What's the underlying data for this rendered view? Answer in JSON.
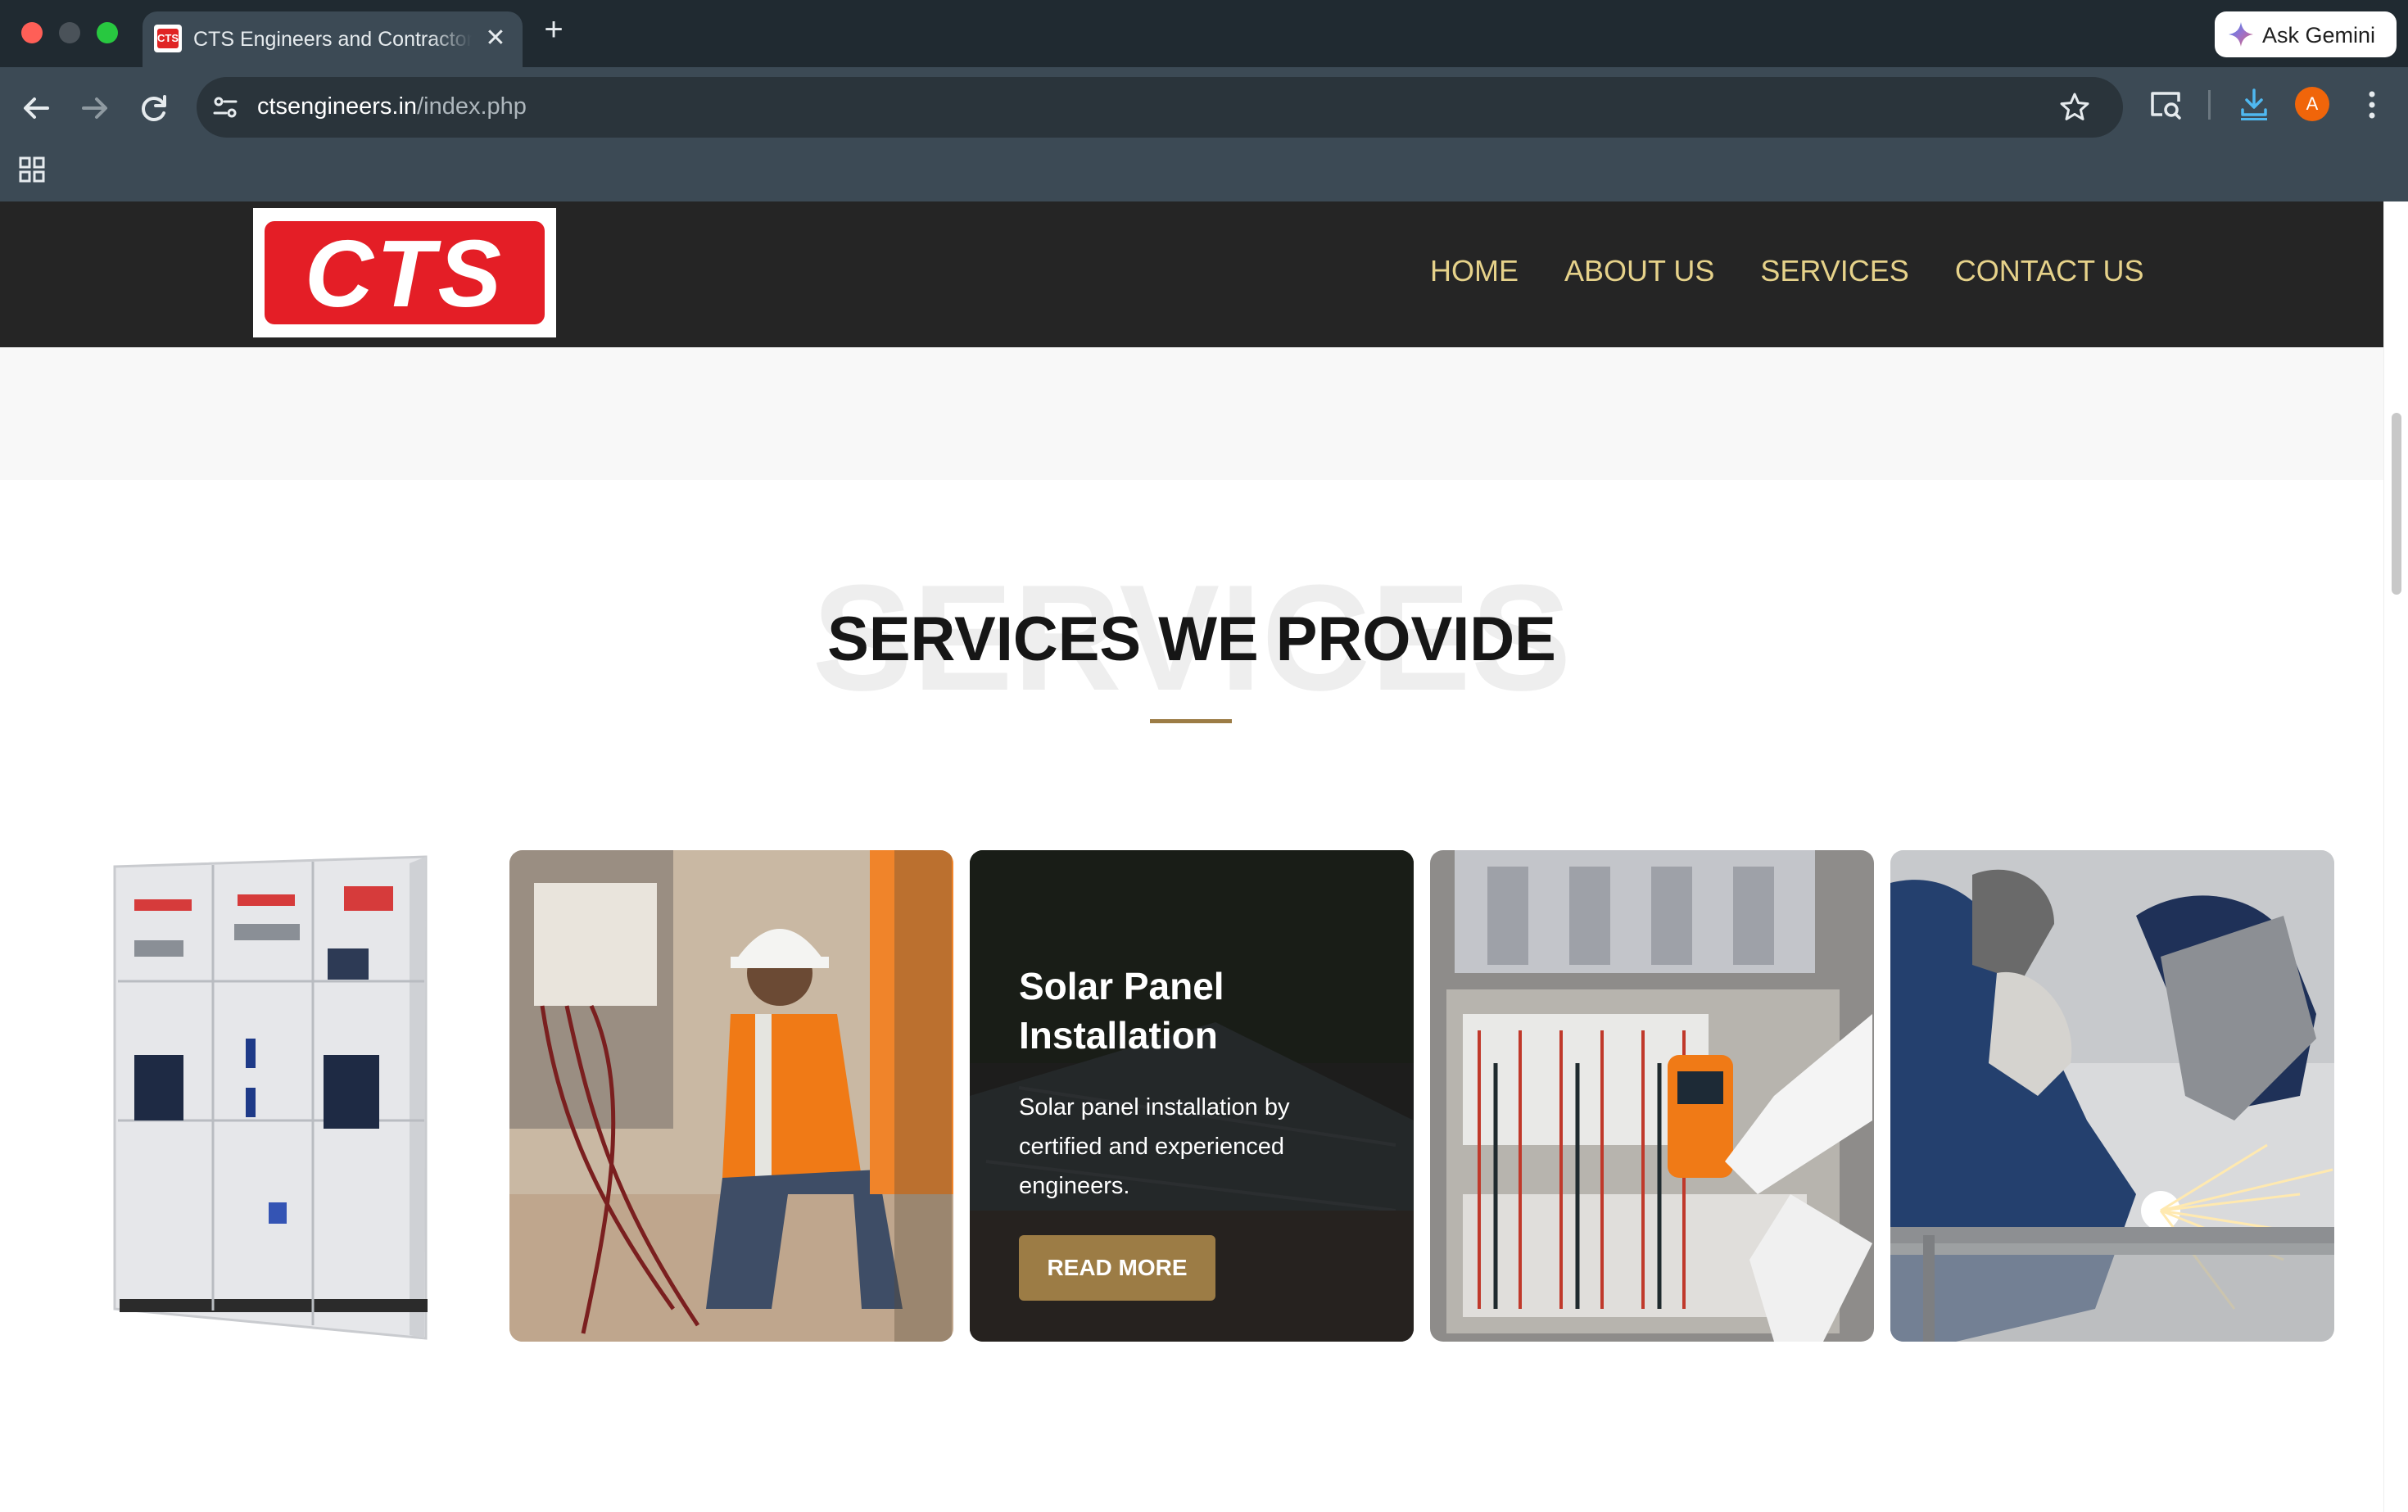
{
  "browser": {
    "tab_title": "CTS Engineers and Contractors",
    "favicon_text": "CTS",
    "new_tab_symbol": "+",
    "close_symbol": "✕",
    "ask_gemini": "Ask Gemini",
    "url_domain": "ctsengineers.in",
    "url_path": "/index.php",
    "profile_initial": "A",
    "icons": [
      "back-arrow-icon",
      "forward-arrow-icon",
      "reload-icon",
      "site-info-icon",
      "bookmark-star-icon",
      "search-tab-icon",
      "download-icon",
      "kebab-menu-icon",
      "apps-grid-icon",
      "gemini-sparkle-icon"
    ]
  },
  "site": {
    "logo_text": "CTS",
    "nav": [
      {
        "label": "HOME"
      },
      {
        "label": "ABOUT US"
      },
      {
        "label": "SERVICES"
      },
      {
        "label": "CONTACT US"
      }
    ],
    "colors": {
      "header_bg": "#252525",
      "nav_text": "#e6d28a",
      "accent": "#9c7c45",
      "logo_red": "#e41e26"
    }
  },
  "services": {
    "watermark": "SERVICES",
    "title": "SERVICES WE PROVIDE",
    "featured": {
      "title": "Solar Panel Installation",
      "description": "Solar panel installation by certified and experienced engineers.",
      "button": "READ MORE"
    }
  }
}
